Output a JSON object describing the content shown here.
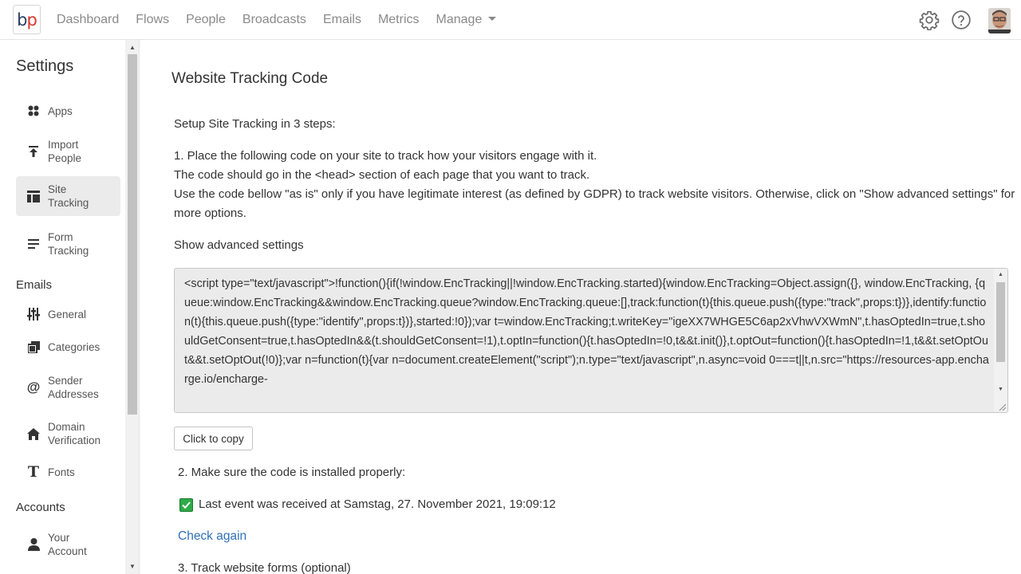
{
  "logo": {
    "b": "b",
    "p": "p"
  },
  "nav": {
    "items": [
      "Dashboard",
      "Flows",
      "People",
      "Broadcasts",
      "Emails",
      "Metrics",
      "Manage"
    ],
    "icons": [
      "gear-icon",
      "help-icon",
      "avatar"
    ]
  },
  "sidebar": {
    "title": "Settings",
    "sections": {
      "emails": "Emails",
      "accounts": "Accounts"
    },
    "items": [
      {
        "label": "Apps",
        "icon": "apps-icon"
      },
      {
        "label": "Import People",
        "icon": "upload-icon"
      },
      {
        "label": "Site Tracking",
        "icon": "layout-icon",
        "active": true
      },
      {
        "label": "Form Tracking",
        "icon": "form-icon"
      },
      {
        "label": "General",
        "icon": "sliders-icon"
      },
      {
        "label": "Categories",
        "icon": "copy-icon"
      },
      {
        "label": "Sender Addresses",
        "icon": "at-icon"
      },
      {
        "label": "Domain Verification",
        "icon": "home-icon"
      },
      {
        "label": "Fonts",
        "icon": "text-icon"
      },
      {
        "label": "Your Account",
        "icon": "person-icon"
      }
    ]
  },
  "main": {
    "title": "Website Tracking Code",
    "intro": "Setup Site Tracking in 3 steps:",
    "step1_line1": "1. Place the following code on your site to track how your visitors engage with it.",
    "step1_line2": "The code should go in the <head> section of each page that you want to track.",
    "step1_line3": "Use the code bellow \"as is\" only if you have legitimate interest (as defined by GDPR) to track website visitors. Otherwise, click on \"Show advanced settings\" for more options.",
    "advanced_link": "Show advanced settings",
    "code": "<script type=\"text/javascript\">!function(){if(!window.EncTracking||!window.EncTracking.started){window.EncTracking=Object.assign({}, window.EncTracking, {queue:window.EncTracking&&window.EncTracking.queue?window.EncTracking.queue:[],track:function(t){this.queue.push({type:\"track\",props:t})},identify:function(t){this.queue.push({type:\"identify\",props:t})},started:!0});var t=window.EncTracking;t.writeKey=\"igeXX7WHGE5C6ap2xVhwVXWmN\",t.hasOptedIn=true,t.shouldGetConsent=true,t.hasOptedIn&&(t.shouldGetConsent=!1),t.optIn=function(){t.hasOptedIn=!0,t&&t.init()},t.optOut=function(){t.hasOptedIn=!1,t&&t.setOptOut&&t.setOptOut(!0)};var n=function(t){var n=document.createElement(\"script\");n.type=\"text/javascript\",n.async=void 0===t||t,n.src=\"https://resources-app.encharge.io/encharge-",
    "copy_button": "Click to copy",
    "step2": "2. Make sure the code is installed properly:",
    "last_event": "Last event was received at Samstag, 27. November 2021, 19:09:12",
    "check_again": "Check again",
    "step3": "3. Track website forms (optional)"
  },
  "colors": {
    "link": "#2f6fb8",
    "check": "#2eaa47",
    "logo_b": "#2d3f64",
    "logo_p": "#d9352c"
  }
}
